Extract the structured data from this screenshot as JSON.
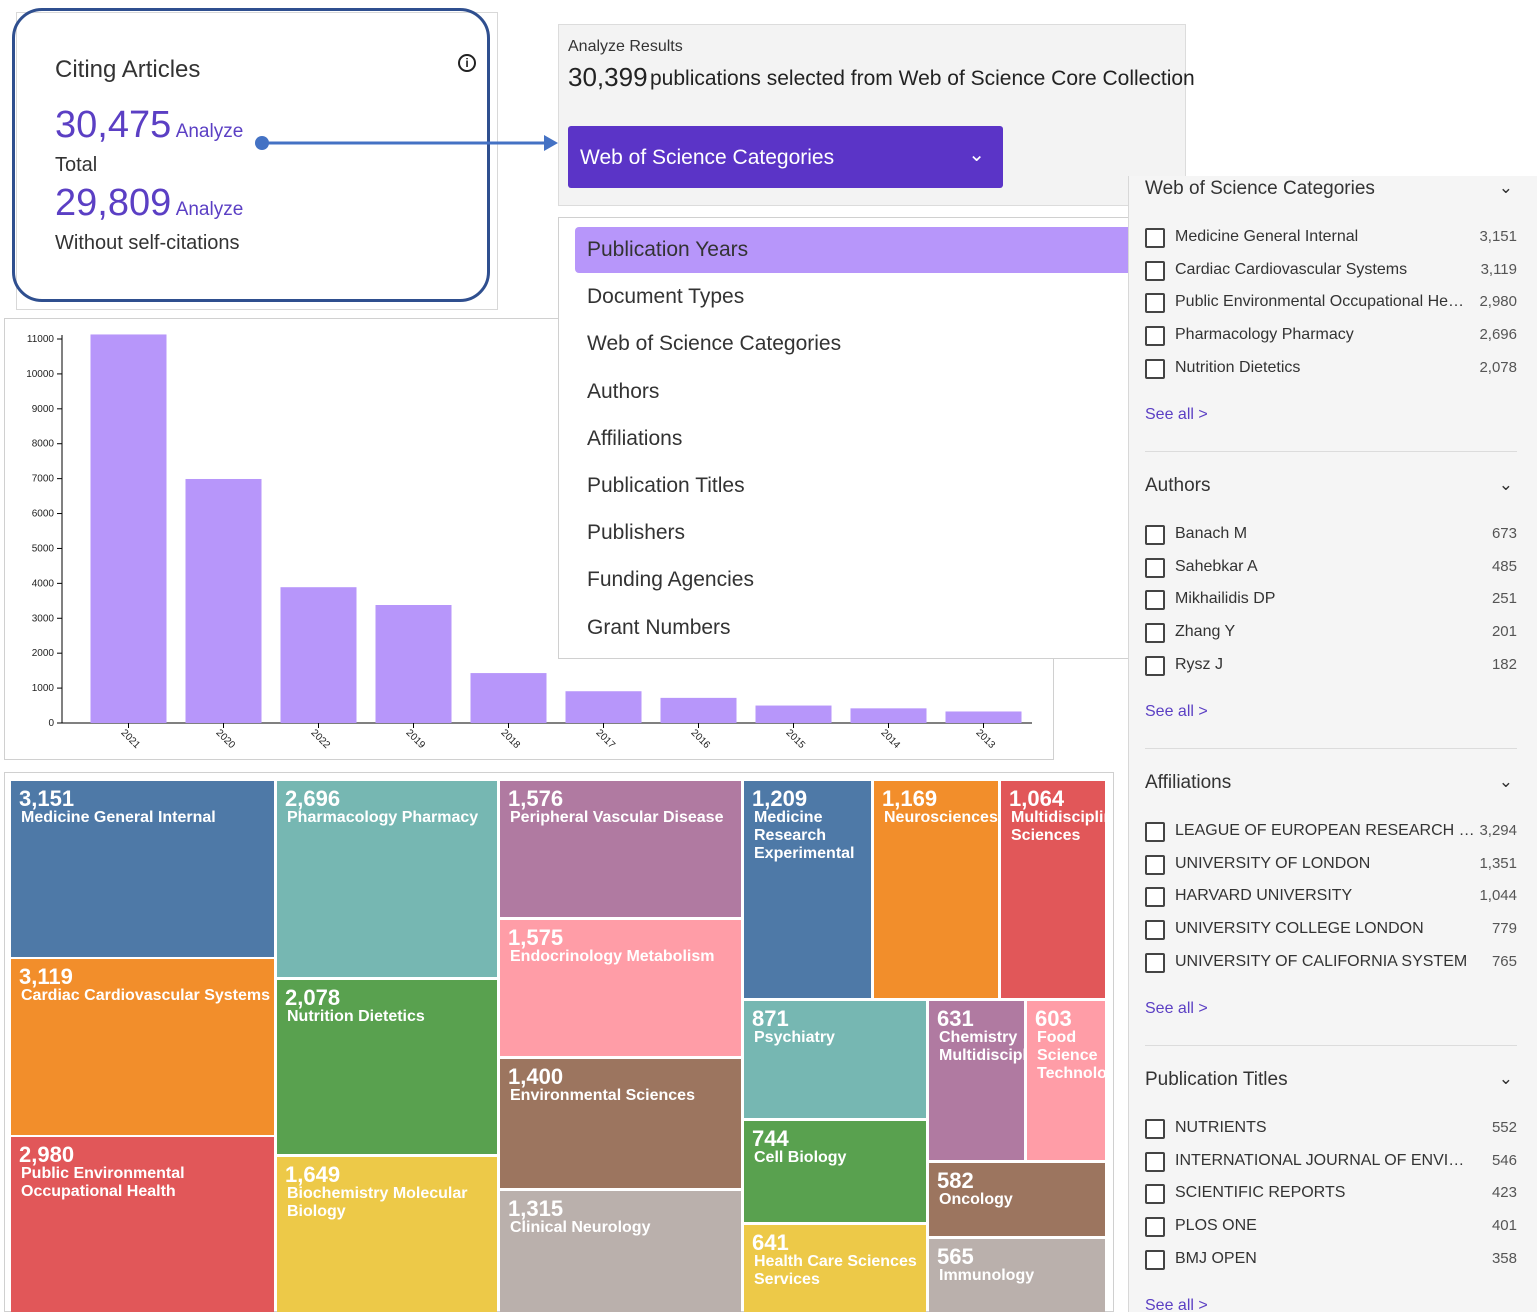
{
  "citing": {
    "title": "Citing Articles",
    "info_icon": "info-icon",
    "total_value": "30,475",
    "total_link": "Analyze",
    "total_label": "Total",
    "self_value": "29,809",
    "self_link": "Analyze",
    "self_label": "Without self-citations"
  },
  "analyze": {
    "label": "Analyze Results",
    "count": "30,399",
    "description": "publications selected from Web of Science Core Collection",
    "select_value": "Web of Science Categories",
    "select_icon": "chevron-down-icon"
  },
  "dropdown": {
    "options": [
      "Publication Years",
      "Document Types",
      "Web of Science Categories",
      "Authors",
      "Affiliations",
      "Publication Titles",
      "Publishers",
      "Funding Agencies",
      "Grant Numbers"
    ],
    "active_index": 0
  },
  "chart_data": {
    "type": "bar",
    "categories": [
      "2021",
      "2020",
      "2022",
      "2019",
      "2018",
      "2017",
      "2016",
      "2015",
      "2014",
      "2013"
    ],
    "values": [
      11130,
      6990,
      3890,
      3380,
      1430,
      910,
      720,
      500,
      420,
      330
    ],
    "yticks": [
      0,
      1000,
      2000,
      3000,
      4000,
      5000,
      6000,
      7000,
      8000,
      9000,
      10000,
      11000
    ],
    "ylim": [
      0,
      11000
    ],
    "bar_color": "#b796fa"
  },
  "treemap": [
    {
      "value": "3,151",
      "label": "Medicine General Internal",
      "color": "#4e79a7"
    },
    {
      "value": "3,119",
      "label": "Cardiac Cardiovascular Systems",
      "color": "#f28e2b"
    },
    {
      "value": "2,980",
      "label": "Public Environmental Occupational Health",
      "color": "#e15759"
    },
    {
      "value": "2,696",
      "label": "Pharmacology Pharmacy",
      "color": "#76b7b2"
    },
    {
      "value": "2,078",
      "label": "Nutrition Dietetics",
      "color": "#59a14f"
    },
    {
      "value": "1,649",
      "label": "Biochemistry Molecular Biology",
      "color": "#edc948"
    },
    {
      "value": "1,576",
      "label": "Peripheral Vascular Disease",
      "color": "#b07aa1"
    },
    {
      "value": "1,575",
      "label": "Endocrinology Metabolism",
      "color": "#ff9da7"
    },
    {
      "value": "1,400",
      "label": "Environmental Sciences",
      "color": "#9c755f"
    },
    {
      "value": "1,315",
      "label": "Clinical Neurology",
      "color": "#bab0ac"
    },
    {
      "value": "1,209",
      "label": "Medicine Research Experimental",
      "color": "#4e79a7"
    },
    {
      "value": "1,169",
      "label": "Neurosciences",
      "color": "#f28e2b"
    },
    {
      "value": "1,064",
      "label": "Multidisciplinary Sciences",
      "color": "#e15759"
    },
    {
      "value": "871",
      "label": "Psychiatry",
      "color": "#76b7b2"
    },
    {
      "value": "744",
      "label": "Cell Biology",
      "color": "#59a14f"
    },
    {
      "value": "641",
      "label": "Health Care Sciences Services",
      "color": "#edc948"
    },
    {
      "value": "631",
      "label": "Chemistry Multidisciplinary",
      "color": "#b07aa1"
    },
    {
      "value": "603",
      "label": "Food Science Technology",
      "color": "#ff9da7"
    },
    {
      "value": "582",
      "label": "Oncology",
      "color": "#9c755f"
    },
    {
      "value": "565",
      "label": "Immunology",
      "color": "#bab0ac"
    }
  ],
  "sidebar": {
    "checkbox_icon": "checkbox-icon",
    "sections": [
      {
        "title": "Web of Science Categories",
        "see_all": "See all >",
        "items": [
          {
            "label": "Medicine General Internal",
            "count": "3,151"
          },
          {
            "label": "Cardiac Cardiovascular Systems",
            "count": "3,119"
          },
          {
            "label": "Public Environmental Occupational He…",
            "count": "2,980"
          },
          {
            "label": "Pharmacology Pharmacy",
            "count": "2,696"
          },
          {
            "label": "Nutrition Dietetics",
            "count": "2,078"
          }
        ]
      },
      {
        "title": "Authors",
        "see_all": "See all >",
        "items": [
          {
            "label": "Banach M",
            "count": "673"
          },
          {
            "label": "Sahebkar A",
            "count": "485"
          },
          {
            "label": "Mikhailidis DP",
            "count": "251"
          },
          {
            "label": "Zhang Y",
            "count": "201"
          },
          {
            "label": "Rysz J",
            "count": "182"
          }
        ]
      },
      {
        "title": "Affiliations",
        "see_all": "See all >",
        "items": [
          {
            "label": "LEAGUE OF EUROPEAN RESEARCH UNI…",
            "count": "3,294"
          },
          {
            "label": "UNIVERSITY OF LONDON",
            "count": "1,351"
          },
          {
            "label": "HARVARD UNIVERSITY",
            "count": "1,044"
          },
          {
            "label": "UNIVERSITY COLLEGE LONDON",
            "count": "779"
          },
          {
            "label": "UNIVERSITY OF CALIFORNIA SYSTEM",
            "count": "765"
          }
        ]
      },
      {
        "title": "Publication Titles",
        "see_all": "See all >",
        "items": [
          {
            "label": "NUTRIENTS",
            "count": "552"
          },
          {
            "label": "INTERNATIONAL JOURNAL OF ENVIRON…",
            "count": "546"
          },
          {
            "label": "SCIENTIFIC REPORTS",
            "count": "423"
          },
          {
            "label": "PLOS ONE",
            "count": "401"
          },
          {
            "label": "BMJ OPEN",
            "count": "358"
          }
        ]
      }
    ]
  }
}
